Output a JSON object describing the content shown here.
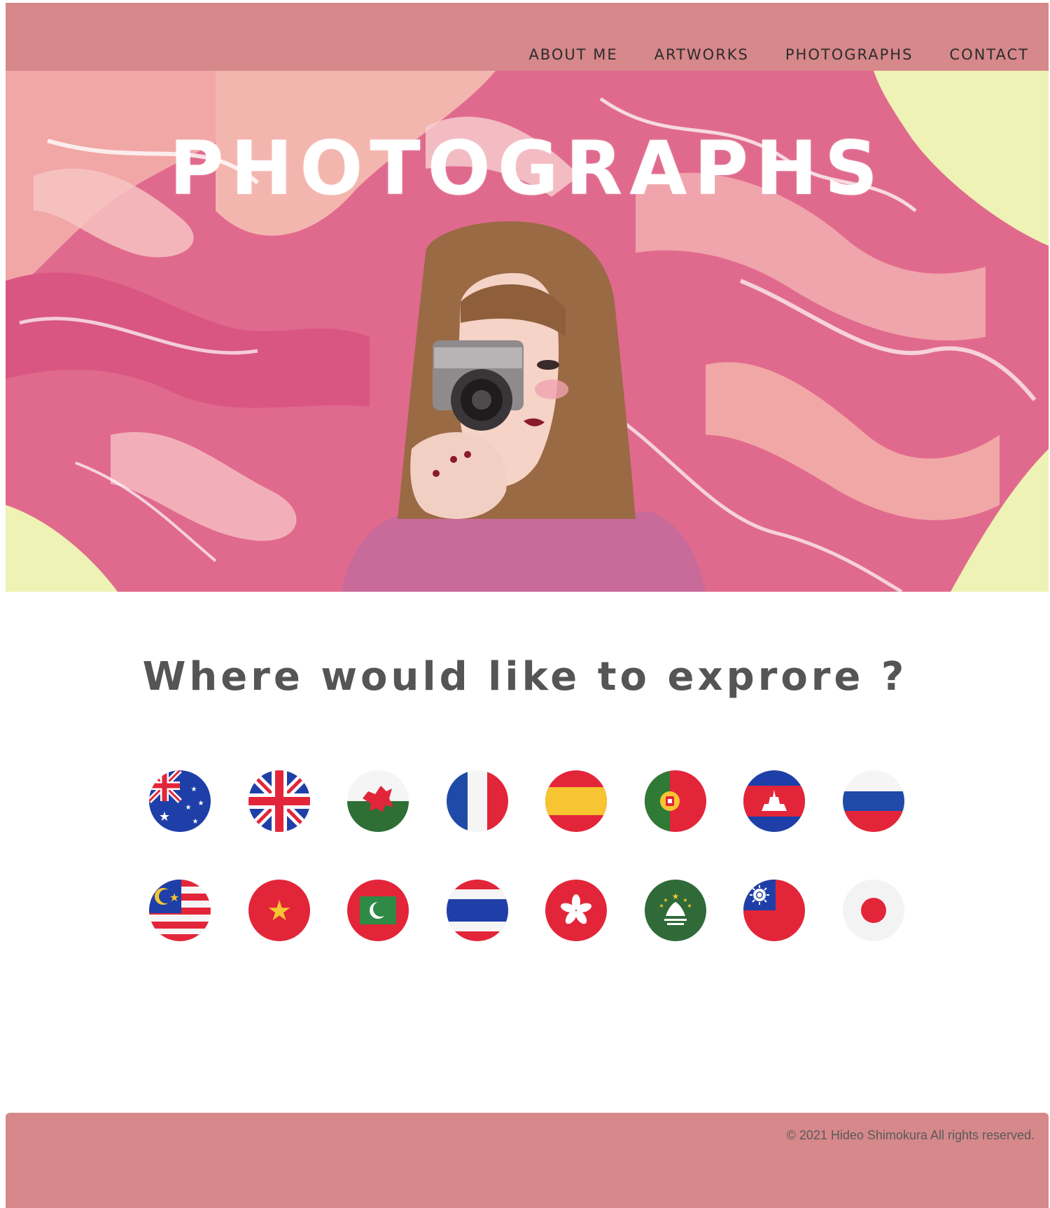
{
  "header": {
    "nav": [
      "ABOUT ME",
      "ARTWORKS",
      "PHOTOGRAPHS",
      "CONTACT"
    ]
  },
  "hero": {
    "title": "PHOTOGRAPHS",
    "image": "woman-holding-camera-illustration-on-pink-marble-background"
  },
  "main": {
    "heading": "Where would like to exprore ?",
    "flags": [
      {
        "icon": "australia-flag-icon"
      },
      {
        "icon": "united-kingdom-flag-icon"
      },
      {
        "icon": "wales-flag-icon"
      },
      {
        "icon": "france-flag-icon"
      },
      {
        "icon": "spain-flag-icon"
      },
      {
        "icon": "portugal-flag-icon"
      },
      {
        "icon": "cambodia-flag-icon"
      },
      {
        "icon": "russia-flag-icon"
      },
      {
        "icon": "malaysia-flag-icon"
      },
      {
        "icon": "vietnam-flag-icon"
      },
      {
        "icon": "maldives-flag-icon"
      },
      {
        "icon": "thailand-flag-icon"
      },
      {
        "icon": "hong-kong-flag-icon"
      },
      {
        "icon": "macau-flag-icon"
      },
      {
        "icon": "taiwan-flag-icon"
      },
      {
        "icon": "japan-flag-icon"
      }
    ]
  },
  "footer": {
    "copyright": "© 2021 Hideo Shimokura All rights reserved."
  },
  "colors": {
    "header_bg": "#d6888a",
    "hero_pink": "#e06a8d",
    "heading_text": "#555555"
  }
}
